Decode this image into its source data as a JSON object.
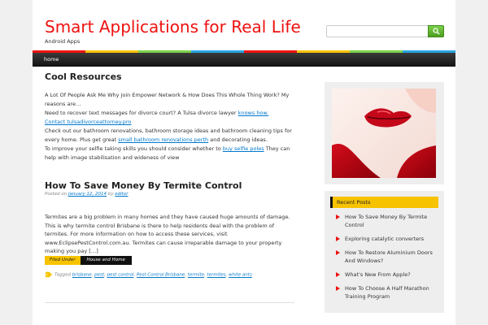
{
  "header": {
    "site_title": "Smart Applications for Real Life",
    "site_description": "Android Apps",
    "search_placeholder": ""
  },
  "colors": {
    "title": "#ee1111",
    "nav_bg": "#1a1a1a",
    "accent_yellow": "#f7c300",
    "link": "#0077cc",
    "strip": [
      "#e11",
      "#f7c300",
      "#7ed04b",
      "#29a3e0",
      "#e11",
      "#f7c300",
      "#7ed04b",
      "#29a3e0"
    ]
  },
  "nav": {
    "items": [
      {
        "label": "home"
      }
    ]
  },
  "cool_resources": {
    "title": "Cool Resources",
    "line1": "A Lot Of People Ask Me Why join Empower Network & How Does This Whole Thing Work? My reasons are…",
    "line2a": "Need to recover text messages for divorce court? A Tulsa divorce lawyer ",
    "link1": "knows how.",
    "link2": "Contact tulsadivorceattorney.pro",
    "line3a": "Check out our bathroom renovations, bathroom storage ideas and bathroom cleaning tips for every home. Plus get great ",
    "link3": "small bathroom renovations perth",
    "line3b": " and decorating ideas.",
    "line4a": "To improve your selfie taking skills you should consider whether to ",
    "link4": "buy selfie poles",
    "line4b": " They can help with image stabilisation and wideness of view"
  },
  "post": {
    "title": "How To Save Money By Termite Control",
    "meta_posted_on": "Posted on ",
    "date": "January 12, 2014",
    "meta_by": " by ",
    "author": "editor",
    "excerpt": "Termites are a big problem in many homes and they have caused huge amounts of damage. This is why termite control Brisbane is there to help residents deal with the problem of termites. For more information on how to access these services, visit www.EclipsePestControl.com.au. Termites can cause irreparable damage to your property making you pay […]",
    "filed_under": "Filed Under",
    "category": "House and Home",
    "tagged": "Tagged ",
    "tags": [
      "brisbane",
      "pest",
      "pest control",
      "Pest Control Brisbane",
      "termite",
      "termites",
      "white ants"
    ]
  },
  "sidebar": {
    "image_icon": "red-lips-photo",
    "recent_posts_title": "Recent Posts",
    "recent_posts": [
      "How To Save Money By Termite Control",
      "Exploring catalytic converters",
      "How To Restore Aluminium Doors And Windows?",
      "What's New From Apple?",
      "How To Choose A Half Marathon Training Program"
    ]
  }
}
